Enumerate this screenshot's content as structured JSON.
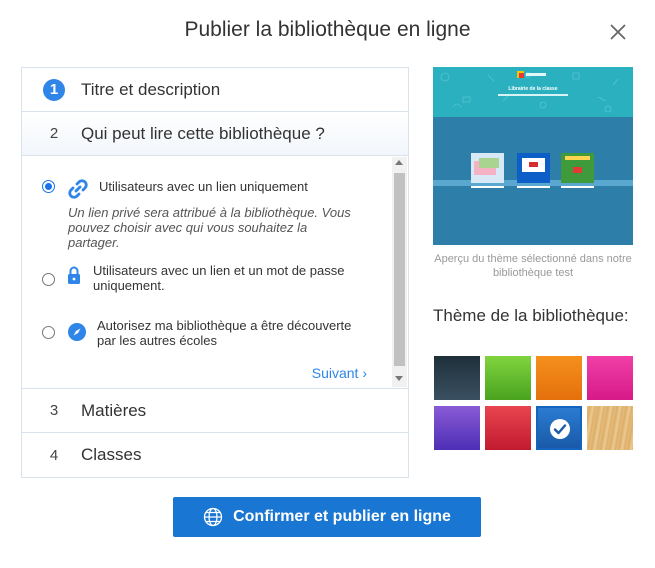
{
  "dialog": {
    "title": "Publier la bibliothèque en ligne",
    "close_icon": "close-icon"
  },
  "steps": [
    {
      "number": "1",
      "label": "Titre et description",
      "state": "done"
    },
    {
      "number": "2",
      "label": "Qui peut lire cette bibliothèque ?",
      "state": "active"
    },
    {
      "number": "3",
      "label": "Matières",
      "state": "pending"
    },
    {
      "number": "4",
      "label": "Classes",
      "state": "pending"
    }
  ],
  "access_options": [
    {
      "label": "Utilisateurs avec un lien uniquement",
      "description": "Un lien privé sera attribué à la bibliothèque. Vous pouvez choisir avec qui vous souhaitez la partager.",
      "icon": "link-icon",
      "selected": true
    },
    {
      "label": "Utilisateurs avec un lien et un mot de passe uniquement.",
      "icon": "lock-icon",
      "selected": false
    },
    {
      "label": "Autorisez ma bibliothèque a être découverte par les autres écoles",
      "icon": "compass-icon",
      "selected": false
    }
  ],
  "next_label": "Suivant ›",
  "preview": {
    "title": "Librairie de la classe",
    "caption": "Aperçu du thème sélectionné dans notre bibliothèque test"
  },
  "theme": {
    "title": "Thème de la bibliothèque:",
    "swatches": [
      {
        "name": "dark-slate",
        "color": "#243a49",
        "selected": false
      },
      {
        "name": "green",
        "color": "#5fbf2a",
        "selected": false
      },
      {
        "name": "orange",
        "color": "#ef7d12",
        "selected": false
      },
      {
        "name": "pink",
        "color": "#ea2a9a",
        "selected": false
      },
      {
        "name": "purple",
        "color": "#6a3fc9",
        "selected": false
      },
      {
        "name": "red",
        "color": "#d8273a",
        "selected": false
      },
      {
        "name": "blue",
        "color": "#1f68b7",
        "selected": true
      },
      {
        "name": "wood",
        "color": "#e3b574",
        "selected": false
      }
    ]
  },
  "confirm": {
    "label": "Confirmer et publier en ligne",
    "icon": "globe-icon"
  },
  "colors": {
    "accent": "#2f86e8",
    "button": "#1976d2"
  }
}
